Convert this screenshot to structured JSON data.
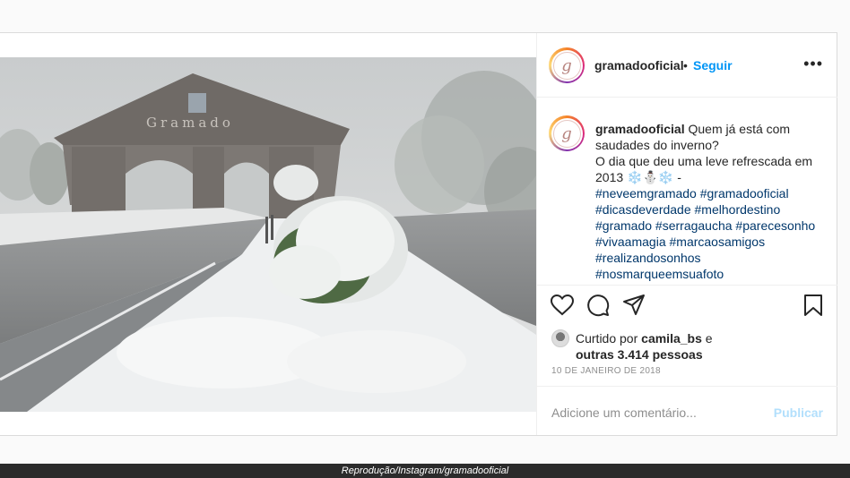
{
  "post": {
    "username": "gramadooficial",
    "dot": "•",
    "follow_label": "Seguir",
    "more_label": "•••",
    "avatar_letter": "g",
    "image_sign_text": "Gramado",
    "caption": {
      "username": "gramadooficial",
      "lines": [
        "Quem já está com",
        "saudades do inverno?",
        "O dia que deu uma leve refrescada em",
        "2013 ❄️⛄❄️ -"
      ],
      "hashtag_lines": [
        "#neveemgramado #gramadooficial",
        "#dicasdeverdade #melhordestino",
        "#gramado #serragaucha #parecesonho",
        "#vivaamagia #marcaosamigos",
        "#realizandosonhos",
        "#nosmarqueemsuafoto"
      ]
    },
    "likes": {
      "prefix": "Curtido por",
      "user": "camila_bs",
      "joiner": "e",
      "others": "outras 3.414 pessoas"
    },
    "date": "10 DE JANEIRO DE 2018",
    "comment": {
      "placeholder": "Adicione um comentário...",
      "publish_label": "Publicar"
    },
    "icons": [
      "heart-icon",
      "comment-icon",
      "share-icon",
      "bookmark-icon",
      "more-options-icon"
    ]
  },
  "credit": "Reprodução/Instagram/gramadooficial",
  "colors": {
    "link_blue": "#0095f6",
    "hashtag": "#00376b",
    "publish_disabled": "#b2dffc",
    "credit_bar": "#2b2b2b"
  }
}
